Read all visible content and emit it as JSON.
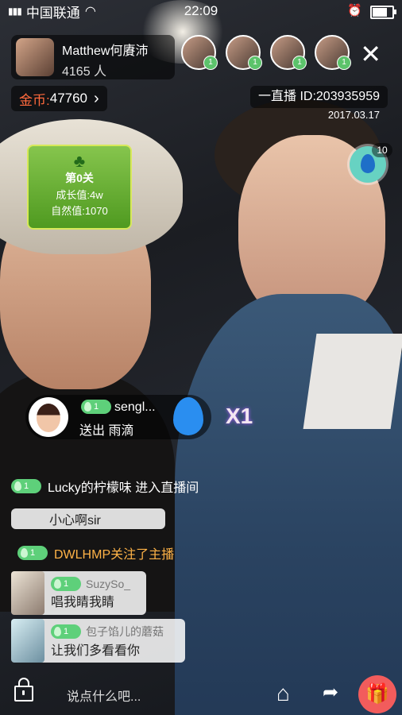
{
  "status_bar": {
    "carrier": "中国联通",
    "time": "22:09"
  },
  "host": {
    "name": "Matthew何賡沛",
    "viewers": "4165 人"
  },
  "viewer_levels": [
    "1",
    "1",
    "1",
    "1"
  ],
  "coins": {
    "label": "金币:",
    "value": "47760"
  },
  "room": {
    "id": "一直播 ID:203935959",
    "date": "2017.03.17"
  },
  "level_card": {
    "stage": "第0关",
    "growth": "成长值:4w",
    "nature": "自然值:1070"
  },
  "water_count": "10",
  "gift": {
    "level": "1",
    "user": "sengl...",
    "message": "送出 雨滴",
    "multiplier": "X1"
  },
  "chat": {
    "join": {
      "level": "1",
      "text": "Lucky的柠檬味 进入直播间"
    },
    "msg1": {
      "text": "小心啊sir"
    },
    "follow": {
      "level": "1",
      "text": "DWLHMP关注了主播"
    },
    "msg2": {
      "level": "1",
      "user": "SuzySo_",
      "text": "唱我睛我睛"
    },
    "msg3": {
      "level": "1",
      "user": "包子馅儿的蘑菇",
      "text": "让我们多看看你"
    }
  },
  "bottom": {
    "input_placeholder": "说点什么吧..."
  }
}
